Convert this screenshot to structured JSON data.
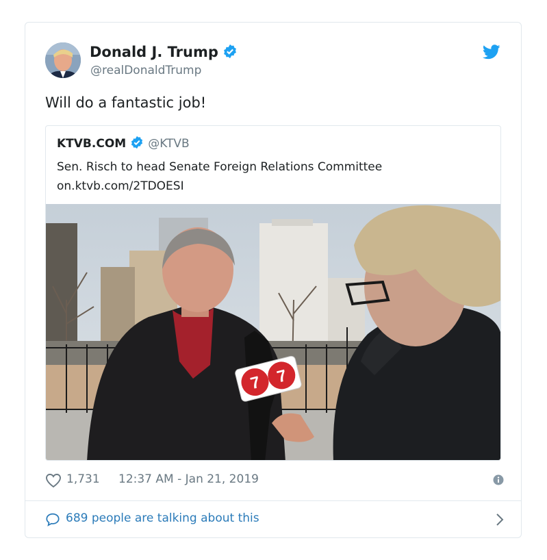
{
  "tweet": {
    "author_name": "Donald J. Trump",
    "author_handle": "@realDonaldTrump",
    "text": "Will do a fantastic job!",
    "likes": "1,731",
    "timestamp": "12:37 AM - Jan 21, 2019",
    "talking": "689 people are talking about this"
  },
  "quote": {
    "author_name": "KTVB.COM",
    "author_handle": "@KTVB",
    "text_line1": "Sen. Risch to head Senate Foreign Relations Committee",
    "text_line2": "on.ktvb.com/2TDOESI"
  },
  "mic_flag": "7",
  "icons": [
    "verified-icon",
    "twitter-bird-icon",
    "heart-icon",
    "info-icon",
    "speech-bubble-icon",
    "chevron-right-icon"
  ],
  "colors": {
    "verified": "#1da1f2",
    "twitter": "#1da1f2",
    "link": "#2b7bb9",
    "muted": "#697882",
    "text": "#1c2022"
  }
}
